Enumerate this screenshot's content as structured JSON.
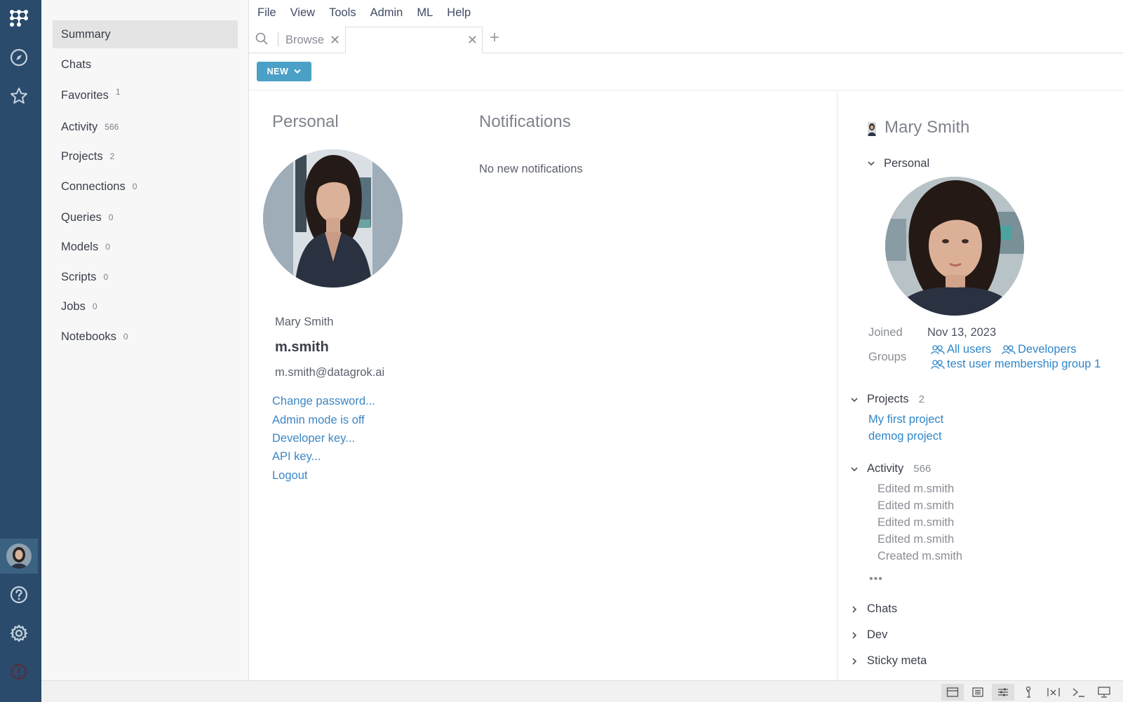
{
  "rail": {
    "icons": [
      "app-logo-icon",
      "compass-icon",
      "star-icon",
      "user-avatar",
      "help-icon",
      "gear-icon",
      "alert-icon"
    ]
  },
  "sidebar": {
    "items": [
      {
        "label": "Summary",
        "count": null
      },
      {
        "label": "Chats",
        "count": null
      },
      {
        "label": "Favorites",
        "count": "1"
      },
      {
        "label": "Activity",
        "count": "566"
      },
      {
        "label": "Projects",
        "count": "2"
      },
      {
        "label": "Connections",
        "count": "0"
      },
      {
        "label": "Queries",
        "count": "0"
      },
      {
        "label": "Models",
        "count": "0"
      },
      {
        "label": "Scripts",
        "count": "0"
      },
      {
        "label": "Jobs",
        "count": "0"
      },
      {
        "label": "Notebooks",
        "count": "0"
      }
    ]
  },
  "menu": [
    "File",
    "View",
    "Tools",
    "Admin",
    "ML",
    "Help"
  ],
  "tabs": {
    "browse_label": "Browse",
    "active_label": "",
    "close_glyph": "✕",
    "add_glyph": "+"
  },
  "toolbar": {
    "new_label": "NEW"
  },
  "main": {
    "personal_title": "Personal",
    "notifications_title": "Notifications",
    "no_notifications": "No new notifications",
    "full_name": "Mary Smith",
    "login": "m.smith",
    "email": "m.smith@datagrok.ai",
    "links": [
      "Change password...",
      "Admin mode is off",
      "Developer key...",
      "API key...",
      "Logout"
    ]
  },
  "panel": {
    "name": "Mary Smith",
    "personal_section": "Personal",
    "joined_label": "Joined",
    "joined_value": "Nov 13, 2023",
    "groups_label": "Groups",
    "groups": [
      "All users",
      "Developers",
      "test user membership group 1"
    ],
    "projects_label": "Projects",
    "projects_count": "2",
    "projects": [
      "My first project",
      "demog project"
    ],
    "activity_label": "Activity",
    "activity_count": "566",
    "activity": [
      "Edited m.smith",
      "Edited m.smith",
      "Edited m.smith",
      "Edited m.smith",
      "Created m.smith"
    ],
    "more": "•••",
    "chats_label": "Chats",
    "dev_label": "Dev",
    "sticky_label": "Sticky meta"
  },
  "colors": {
    "rail": "#2a4b6b",
    "accent": "#4aa0c6",
    "link": "#2f86c9"
  }
}
